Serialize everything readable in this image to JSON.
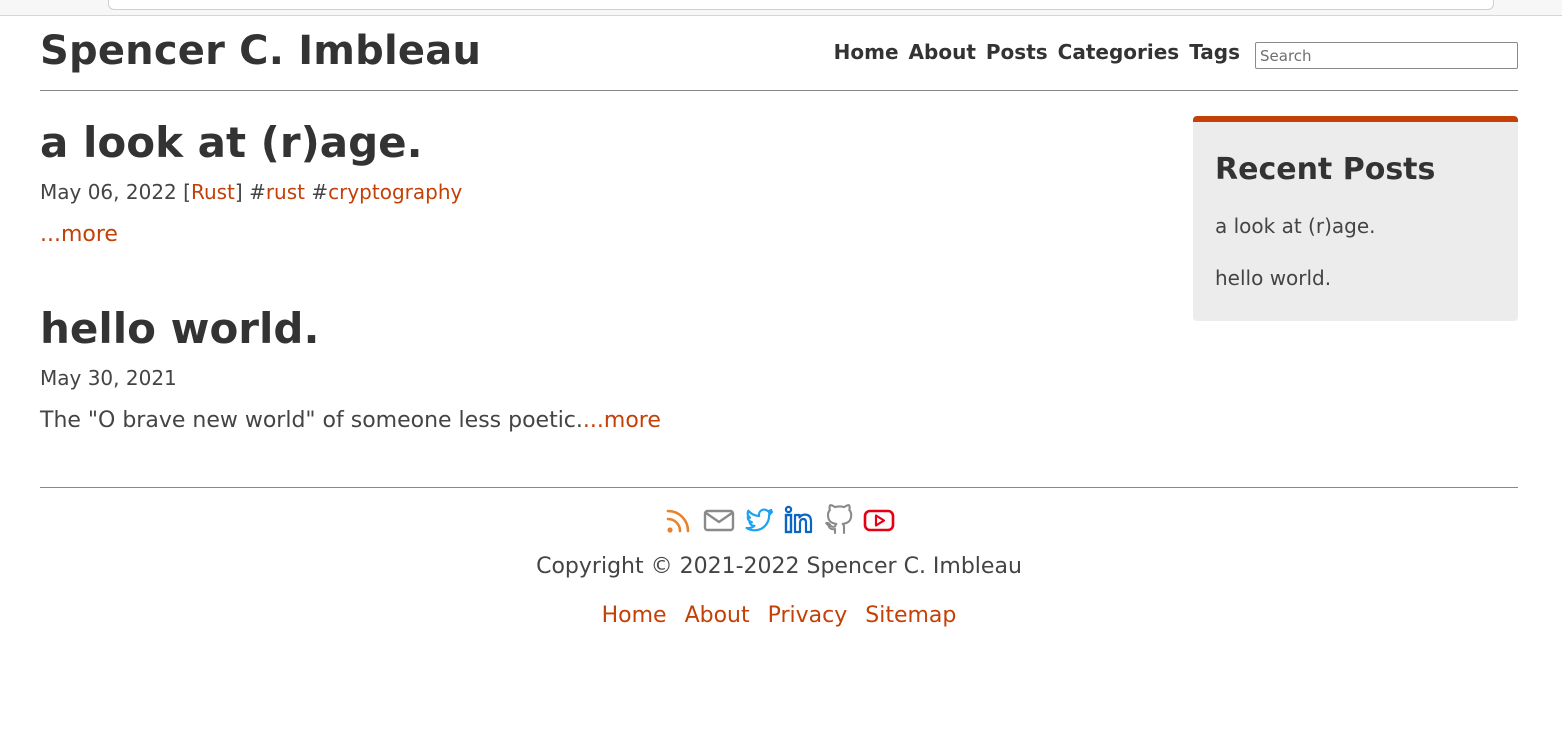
{
  "site": {
    "title": "Spencer C. Imbleau"
  },
  "nav": [
    "Home",
    "About",
    "Posts",
    "Categories",
    "Tags"
  ],
  "search": {
    "placeholder": "Search"
  },
  "posts": [
    {
      "title": "a look at (r)age.",
      "date": "May 06, 2022",
      "category": "Rust",
      "tags": [
        "rust",
        "cryptography"
      ],
      "summary": "",
      "more": "...more"
    },
    {
      "title": "hello world.",
      "date": "May 30, 2021",
      "summary": "The \"O brave new world\" of someone less poetic.",
      "more": "...more"
    }
  ],
  "sidebar": {
    "title": "Recent Posts",
    "items": [
      "a look at (r)age.",
      "hello world."
    ]
  },
  "footer": {
    "social_icons": [
      "rss-icon",
      "email-icon",
      "twitter-icon",
      "linkedin-icon",
      "github-icon",
      "youtube-icon"
    ],
    "copyright": "Copyright © 2021-2022 Spencer C. Imbleau",
    "links": [
      "Home",
      "About",
      "Privacy",
      "Sitemap"
    ]
  },
  "colors": {
    "accent": "#c44006",
    "text": "#333333",
    "sidebar_bg": "#ececec",
    "rss": "#e8822c",
    "twitter": "#1da1f2",
    "linkedin": "#0a66c2",
    "youtube": "#e60012",
    "icon_gray": "#8a8a8a"
  }
}
